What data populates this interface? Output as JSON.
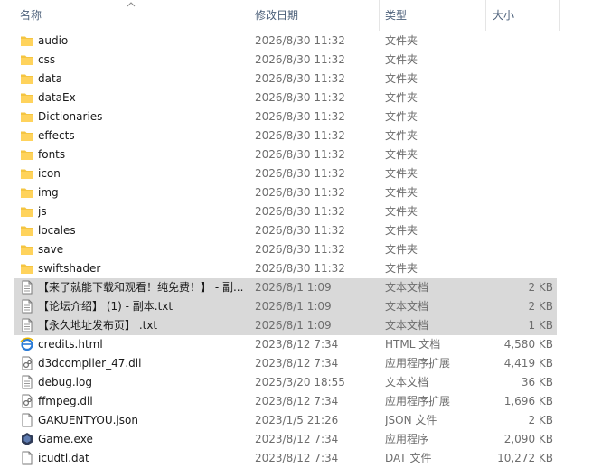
{
  "columns": {
    "name": "名称",
    "date": "修改日期",
    "type": "类型",
    "size": "大小"
  },
  "rows": [
    {
      "name": "audio",
      "date": "2026/8/30 11:32",
      "type": "文件夹",
      "size": "",
      "icon": "folder-icon",
      "selected": false
    },
    {
      "name": "css",
      "date": "2026/8/30 11:32",
      "type": "文件夹",
      "size": "",
      "icon": "folder-icon",
      "selected": false
    },
    {
      "name": "data",
      "date": "2026/8/30 11:32",
      "type": "文件夹",
      "size": "",
      "icon": "folder-icon",
      "selected": false
    },
    {
      "name": "dataEx",
      "date": "2026/8/30 11:32",
      "type": "文件夹",
      "size": "",
      "icon": "folder-icon",
      "selected": false
    },
    {
      "name": "Dictionaries",
      "date": "2026/8/30 11:32",
      "type": "文件夹",
      "size": "",
      "icon": "folder-icon",
      "selected": false
    },
    {
      "name": "effects",
      "date": "2026/8/30 11:32",
      "type": "文件夹",
      "size": "",
      "icon": "folder-icon",
      "selected": false
    },
    {
      "name": "fonts",
      "date": "2026/8/30 11:32",
      "type": "文件夹",
      "size": "",
      "icon": "folder-icon",
      "selected": false
    },
    {
      "name": "icon",
      "date": "2026/8/30 11:32",
      "type": "文件夹",
      "size": "",
      "icon": "folder-icon",
      "selected": false
    },
    {
      "name": "img",
      "date": "2026/8/30 11:32",
      "type": "文件夹",
      "size": "",
      "icon": "folder-icon",
      "selected": false
    },
    {
      "name": "js",
      "date": "2026/8/30 11:32",
      "type": "文件夹",
      "size": "",
      "icon": "folder-icon",
      "selected": false
    },
    {
      "name": "locales",
      "date": "2026/8/30 11:32",
      "type": "文件夹",
      "size": "",
      "icon": "folder-icon",
      "selected": false
    },
    {
      "name": "save",
      "date": "2026/8/30 11:32",
      "type": "文件夹",
      "size": "",
      "icon": "folder-icon",
      "selected": false
    },
    {
      "name": "swiftshader",
      "date": "2026/8/30 11:32",
      "type": "文件夹",
      "size": "",
      "icon": "folder-icon",
      "selected": false
    },
    {
      "name": "【来了就能下载和观看！纯免费！】 - 副...",
      "date": "2026/8/1 1:09",
      "type": "文本文档",
      "size": "2 KB",
      "icon": "text-file-icon",
      "selected": true
    },
    {
      "name": "【论坛介绍】 (1) - 副本.txt",
      "date": "2026/8/1 1:09",
      "type": "文本文档",
      "size": "2 KB",
      "icon": "text-file-icon",
      "selected": true
    },
    {
      "name": "【永久地址发布页】 .txt",
      "date": "2026/8/1 1:09",
      "type": "文本文档",
      "size": "1 KB",
      "icon": "text-file-icon",
      "selected": true
    },
    {
      "name": "credits.html",
      "date": "2023/8/12 7:34",
      "type": "HTML 文档",
      "size": "4,580 KB",
      "icon": "html-file-icon",
      "selected": false
    },
    {
      "name": "d3dcompiler_47.dll",
      "date": "2023/8/12 7:34",
      "type": "应用程序扩展",
      "size": "4,419 KB",
      "icon": "dll-file-icon",
      "selected": false
    },
    {
      "name": "debug.log",
      "date": "2025/3/20 18:55",
      "type": "文本文档",
      "size": "36 KB",
      "icon": "text-file-icon",
      "selected": false
    },
    {
      "name": "ffmpeg.dll",
      "date": "2023/8/12 7:34",
      "type": "应用程序扩展",
      "size": "1,696 KB",
      "icon": "dll-file-icon",
      "selected": false
    },
    {
      "name": "GAKUENTYOU.json",
      "date": "2023/1/5 21:26",
      "type": "JSON 文件",
      "size": "2 KB",
      "icon": "blank-file-icon",
      "selected": false
    },
    {
      "name": "Game.exe",
      "date": "2023/8/12 7:34",
      "type": "应用程序",
      "size": "2,090 KB",
      "icon": "game-exe-icon",
      "selected": false
    },
    {
      "name": "icudtl.dat",
      "date": "2023/8/12 7:34",
      "type": "DAT 文件",
      "size": "10,272 KB",
      "icon": "blank-file-icon",
      "selected": false
    }
  ]
}
